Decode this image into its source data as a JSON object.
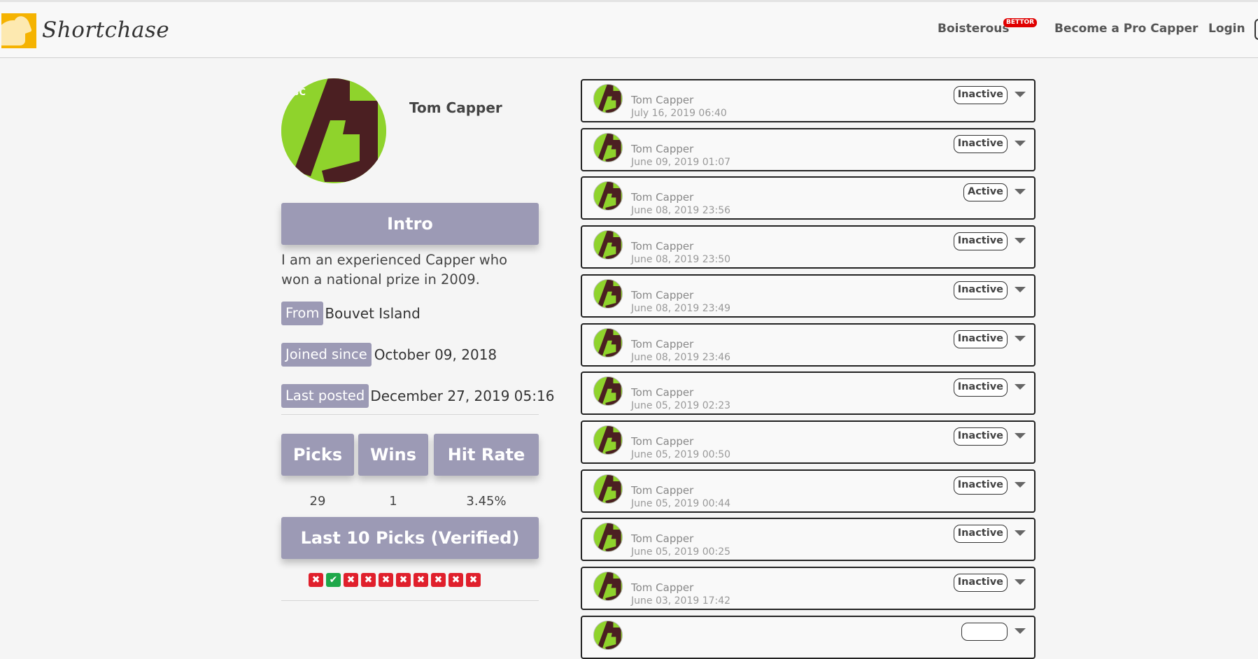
{
  "header": {
    "brand": "Shortchase",
    "nav": {
      "user": "Boisterous",
      "user_badge": "BETTOR",
      "become_pro": "Become a Pro Capper",
      "login": "Login"
    }
  },
  "profile": {
    "name": "Tom Capper",
    "intro_label": "Intro",
    "intro_text": "I am an experienced Capper who won a national prize in 2009.",
    "from_label": "From",
    "from_value": "Bouvet Island",
    "joined_label": "Joined since",
    "joined_value": "October 09, 2018",
    "last_posted_label": "Last posted",
    "last_posted_value": "December 27, 2019 05:16",
    "stats": {
      "picks_label": "Picks",
      "wins_label": "Wins",
      "hit_rate_label": "Hit Rate",
      "picks_value": "29",
      "wins_value": "1",
      "hit_rate_value": "3.45%"
    },
    "last10_label": "Last 10 Picks (Verified)",
    "last10_results": [
      "loss",
      "win",
      "loss",
      "loss",
      "loss",
      "loss",
      "loss",
      "loss",
      "loss",
      "loss"
    ]
  },
  "picks": [
    {
      "name": "Tom Capper",
      "date": "July 16, 2019 06:40",
      "status": "Inactive"
    },
    {
      "name": "Tom Capper",
      "date": "June 09, 2019 01:07",
      "status": "Inactive"
    },
    {
      "name": "Tom Capper",
      "date": "June 08, 2019 23:56",
      "status": "Active"
    },
    {
      "name": "Tom Capper",
      "date": "June 08, 2019 23:50",
      "status": "Inactive"
    },
    {
      "name": "Tom Capper",
      "date": "June 08, 2019 23:49",
      "status": "Inactive"
    },
    {
      "name": "Tom Capper",
      "date": "June 08, 2019 23:46",
      "status": "Inactive"
    },
    {
      "name": "Tom Capper",
      "date": "June 05, 2019 02:23",
      "status": "Inactive"
    },
    {
      "name": "Tom Capper",
      "date": "June 05, 2019 00:50",
      "status": "Inactive"
    },
    {
      "name": "Tom Capper",
      "date": "June 05, 2019 00:44",
      "status": "Inactive"
    },
    {
      "name": "Tom Capper",
      "date": "June 05, 2019 00:25",
      "status": "Inactive"
    },
    {
      "name": "Tom Capper",
      "date": "June 03, 2019 17:42",
      "status": "Inactive"
    },
    {
      "name": "",
      "date": "",
      "status": ""
    }
  ],
  "colors": {
    "accent": "#9c9ab5",
    "loss": "#e0202c",
    "win": "#1fa84a",
    "avatar_bg": "#8fd32c",
    "avatar_mark": "#4b1f22"
  },
  "icons": {
    "logo": "horse-logo-icon",
    "avatar": "capper-avatar-icon",
    "caret": "chevron-down-icon",
    "loss": "x-mark-icon",
    "win": "check-mark-icon"
  }
}
